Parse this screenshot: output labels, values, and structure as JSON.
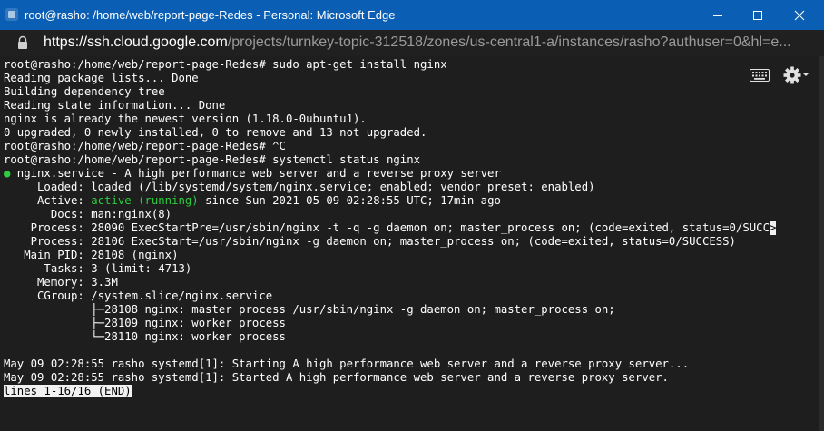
{
  "window": {
    "title": "root@rasho: /home/web/report-page-Redes - Personal: Microsoft Edge",
    "controls": {
      "minimize": "—",
      "maximize": "☐",
      "close": "✕"
    }
  },
  "address": {
    "host": "https://ssh.cloud.google.com",
    "path": "/projects/turnkey-topic-312518/zones/us-central1-a/instances/rasho?authuser=0&hl=e..."
  },
  "terminal": {
    "lines": [
      {
        "text": "root@rasho:/home/web/report-page-Redes# sudo apt-get install nginx"
      },
      {
        "text": "Reading package lists... Done"
      },
      {
        "text": "Building dependency tree"
      },
      {
        "text": "Reading state information... Done"
      },
      {
        "text": "nginx is already the newest version (1.18.0-0ubuntu1)."
      },
      {
        "text": "0 upgraded, 0 newly installed, 0 to remove and 13 not upgraded."
      },
      {
        "text": "root@rasho:/home/web/report-page-Redes# ^C"
      },
      {
        "text": "root@rasho:/home/web/report-page-Redes# systemctl status nginx"
      },
      {
        "text": "● nginx.service - A high performance web server and a reverse proxy server",
        "dot": "●",
        "rest": " nginx.service - A high performance web server and a reverse proxy server"
      },
      {
        "text": "     Loaded: loaded (/lib/systemd/system/nginx.service; enabled; vendor preset: enabled)"
      },
      {
        "text": "     Active: active (running) since Sun 2021-05-09 02:28:55 UTC; 17min ago",
        "prefix": "     Active: ",
        "status": "active (running)",
        "rest": " since Sun 2021-05-09 02:28:55 UTC; 17min ago"
      },
      {
        "text": "       Docs: man:nginx(8)"
      },
      {
        "text": "    Process: 28090 ExecStartPre=/usr/sbin/nginx -t -q -g daemon on; master_process on; (code=exited, status=0/SUCC",
        "cut": ">"
      },
      {
        "text": "    Process: 28106 ExecStart=/usr/sbin/nginx -g daemon on; master_process on; (code=exited, status=0/SUCCESS)"
      },
      {
        "text": "   Main PID: 28108 (nginx)"
      },
      {
        "text": "      Tasks: 3 (limit: 4713)"
      },
      {
        "text": "     Memory: 3.3M"
      },
      {
        "text": "     CGroup: /system.slice/nginx.service"
      },
      {
        "text": "             ├─28108 nginx: master process /usr/sbin/nginx -g daemon on; master_process on;"
      },
      {
        "text": "             ├─28109 nginx: worker process"
      },
      {
        "text": "             └─28110 nginx: worker process"
      },
      {
        "text": ""
      },
      {
        "text": "May 09 02:28:55 rasho systemd[1]: Starting A high performance web server and a reverse proxy server..."
      },
      {
        "text": "May 09 02:28:55 rasho systemd[1]: Started A high performance web server and a reverse proxy server."
      },
      {
        "text": "lines 1-16/16 (END)"
      }
    ]
  },
  "icons": {
    "app": "edge-favicon-icon",
    "lock": "lock-icon",
    "keyboard": "keyboard-icon",
    "settings": "gear-icon"
  },
  "colors": {
    "titlebar": "#0a5fb4",
    "terminal_bg": "#1e1e1e",
    "green": "#2ecc40"
  }
}
